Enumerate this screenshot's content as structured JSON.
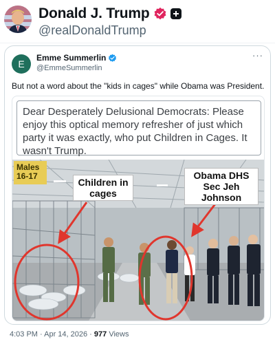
{
  "post": {
    "author_name": "Donald J. Trump",
    "author_handle": "@realDonaldTrump",
    "timestamp": "4:03 PM · Apr 14, 2026 · ",
    "views_count": "977",
    "views_label": " Views"
  },
  "quoted_post": {
    "avatar_letter": "E",
    "author_name": "Emme Summerlin",
    "author_handle": "@EmmeSummerlin",
    "more_label": "···",
    "text": "But not a word about the \"kids in cages\" while Obama was President.",
    "image": {
      "caption": "Dear Desperately Delusional Democrats: Please enjoy this optical memory refresher of just which party it was exactly, who put Children in Cages. It wasn't Trump.",
      "sign_text": "Males 16-17",
      "label_left": "Children in cages",
      "label_right": "Obama DHS Sec Jeh Johnson"
    }
  },
  "colors": {
    "verified_blue": "#1d9bf0",
    "verified_pink": "#e0245e",
    "annotation_red": "#e0362d"
  },
  "icons": [
    "verified-badge-icon",
    "affiliate-badge-icon",
    "more-options-icon",
    "annotation-arrow-icon"
  ]
}
